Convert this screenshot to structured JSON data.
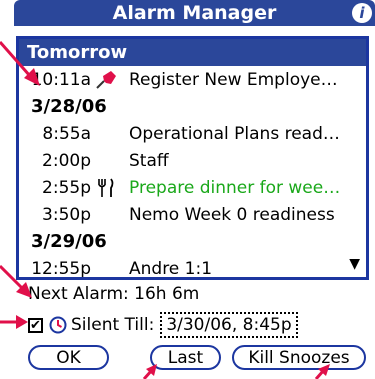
{
  "title": "Alarm Manager",
  "groups": [
    {
      "label": "Tomorrow",
      "highlight": true,
      "items": [
        {
          "time": "10:11a",
          "icon": "pushpin-icon",
          "desc": "Register New Employe…"
        }
      ]
    },
    {
      "label": "3/28/06",
      "items": [
        {
          "time": "8:55a",
          "icon": "",
          "desc": "Operational Plans read…"
        },
        {
          "time": "2:00p",
          "icon": "",
          "desc": "Staff"
        },
        {
          "time": "2:55p",
          "icon": "fork-knife-icon",
          "desc": "Prepare dinner for wee…",
          "color": "#1aa81a"
        },
        {
          "time": "3:50p",
          "icon": "",
          "desc": "Nemo Week 0 readiness"
        }
      ]
    },
    {
      "label": "3/29/06",
      "items": [
        {
          "time": "12:55p",
          "icon": "",
          "desc": "Andre 1:1"
        }
      ]
    }
  ],
  "status": "Next Alarm:  16h 6m",
  "silent": {
    "checked": true,
    "label": "Silent Till:",
    "value": "3/30/06, 8:45p"
  },
  "buttons": {
    "ok": "OK",
    "last": "Last",
    "kill": "Kill Snoozes"
  },
  "colors": {
    "accent": "#2b479a",
    "border": "#1c36a0",
    "green": "#1aa81a",
    "annotation": "#e0104a"
  }
}
